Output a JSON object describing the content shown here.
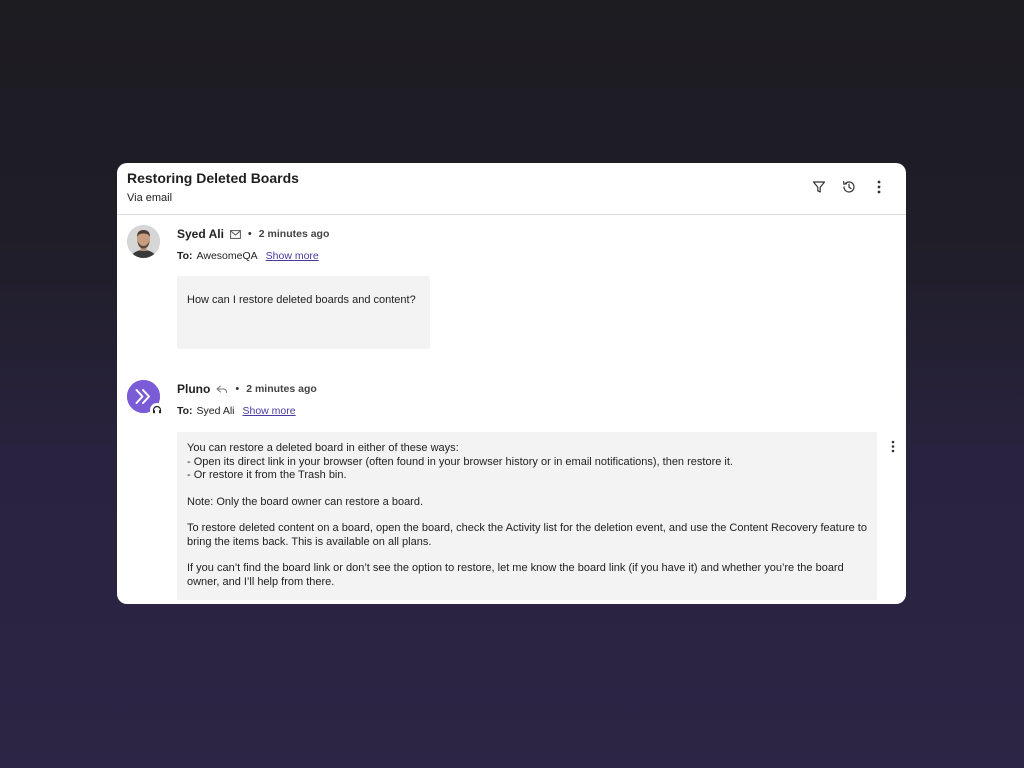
{
  "header": {
    "title": "Restoring Deleted Boards",
    "subtitle": "Via email"
  },
  "icons": {
    "filter": "filter-icon",
    "history": "history-icon",
    "more": "more-vertical-icon",
    "mail": "mail-icon",
    "reply": "reply-icon",
    "headset": "headset-icon"
  },
  "colors": {
    "bot_avatar": "#7b5bd6",
    "link": "#4a3aa0",
    "bubble": "#f3f3f3"
  },
  "messages": [
    {
      "sender": "Syed Ali",
      "separator": "•",
      "time": "2 minutes ago",
      "to_label": "To:",
      "to_value": "AwesomeQA",
      "show_more": "Show more",
      "body": [
        "How can I restore deleted boards and content?"
      ]
    },
    {
      "sender": "Pluno",
      "separator": "•",
      "time": "2 minutes ago",
      "to_label": "To:",
      "to_value": "Syed Ali",
      "show_more": "Show more",
      "body": [
        "You can restore a deleted board in either of these ways:\n- Open its direct link in your browser (often found in your browser history or in email notifications), then restore it.\n- Or restore it from the Trash bin.",
        "Note: Only the board owner can restore a board.",
        "To restore deleted content on a board, open the board, check the Activity list for the deletion event, and use the Content Recovery feature to bring the items back. This is available on all plans.",
        "If you can’t find the board link or don’t see the option to restore, let me know the board link (if you have it) and whether you’re the board owner, and I’ll help from there."
      ]
    }
  ]
}
